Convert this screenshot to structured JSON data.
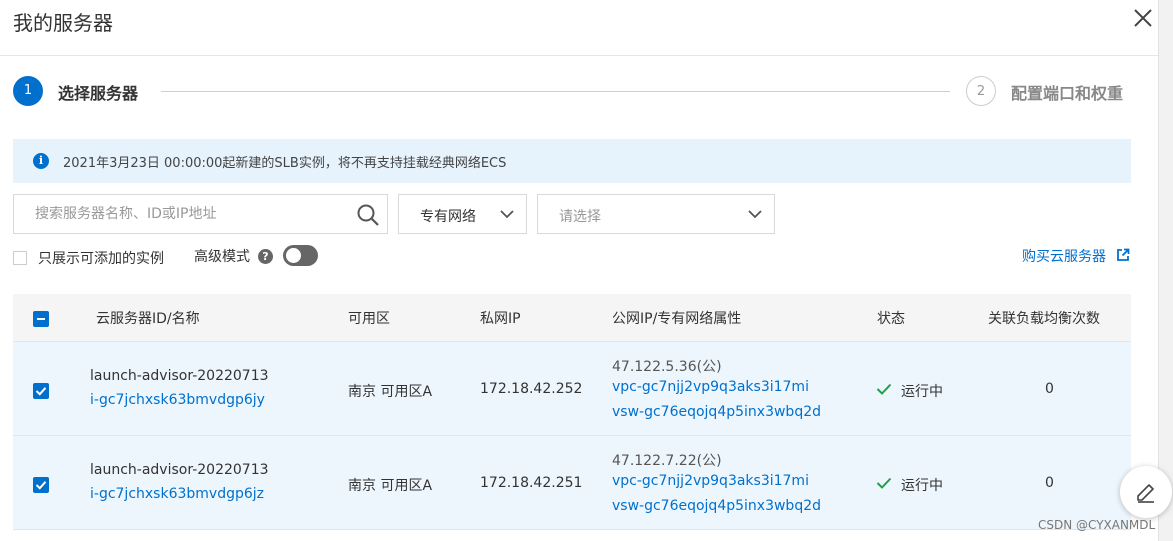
{
  "dialog": {
    "title": "我的服务器"
  },
  "steps": [
    {
      "number": "1",
      "label": "选择服务器"
    },
    {
      "number": "2",
      "label": "配置端口和权重"
    }
  ],
  "notice": {
    "text": "2021年3月23日 00:00:00起新建的SLB实例，将不再支持挂载经典网络ECS"
  },
  "filters": {
    "search_placeholder": "搜索服务器名称、ID或IP地址",
    "network_type": "专有网络",
    "choose_placeholder": "请选择"
  },
  "options": {
    "only_addable": "只展示可添加的实例",
    "advanced_mode": "高级模式",
    "buy_link": "购买云服务器"
  },
  "table": {
    "headers": [
      "云服务器ID/名称",
      "可用区",
      "私网IP",
      "公网IP/专有网络属性",
      "状态",
      "关联负载均衡次数"
    ],
    "rows": [
      {
        "name": "launch-advisor-20220713",
        "id": "i-gc7jchxsk63bmvdgp6jy",
        "zone": "南京 可用区A",
        "private_ip": "172.18.42.252",
        "public_ip": "47.122.5.36(公)",
        "vpc": "vpc-gc7njj2vp9q3aks3i17mi",
        "vsw": "vsw-gc76eqojq4p5inx3wbq2d",
        "status": "运行中",
        "lb_count": "0",
        "checked": true
      },
      {
        "name": "launch-advisor-20220713",
        "id": "i-gc7jchxsk63bmvdgp6jz",
        "zone": "南京 可用区A",
        "private_ip": "172.18.42.251",
        "public_ip": "47.122.7.22(公)",
        "vpc": "vpc-gc7njj2vp9q3aks3i17mi",
        "vsw": "vsw-gc76eqojq4p5inx3wbq2d",
        "status": "运行中",
        "lb_count": "0",
        "checked": true
      }
    ]
  },
  "colors": {
    "accent": "#0070cc",
    "success": "#1aa14b",
    "notice_bg": "#e6f2fc",
    "row_selected_bg": "#eef6fd"
  },
  "icons": [
    "close-icon",
    "info-icon",
    "search-icon",
    "chevron-down-icon",
    "help-icon",
    "external-link-icon",
    "check-icon",
    "edit-icon"
  ],
  "watermark": "CSDN @CYXANMDL"
}
